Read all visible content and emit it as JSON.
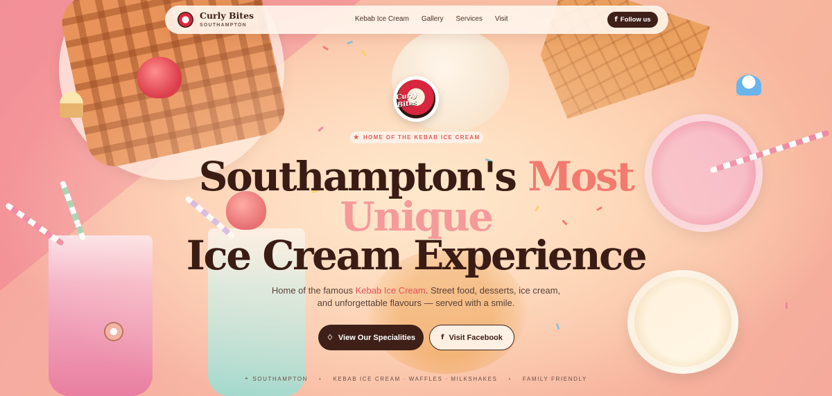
{
  "nav": {
    "brand_name": "Curly Bites",
    "brand_sub": "SOUTHAMPTON",
    "menu": [
      {
        "label": "Kebab Ice Cream"
      },
      {
        "label": "Gallery"
      },
      {
        "label": "Services"
      },
      {
        "label": "Visit"
      }
    ],
    "follow_label": "Follow us"
  },
  "hero": {
    "logo_text": "Curly Bites",
    "badge": "HOME OF THE KEBAB ICE CREAM",
    "title_line1_a": "Southampton's ",
    "title_line1_b": "Most",
    "title_line2": "Unique",
    "title_line3": "Ice Cream Experience",
    "subtitle_a": "Home of the famous ",
    "subtitle_highlight": "Kebab Ice Cream",
    "subtitle_b": ". Street food, desserts, ice cream,",
    "subtitle_line2": "and unforgettable flavours — served with a smile.",
    "primary_button": "View Our Specialities",
    "secondary_button": "Visit Facebook"
  },
  "info_bar": {
    "location": "SOUTHAMPTON",
    "products": "KEBAB ICE CREAM · WAFFLES · MILKSHAKES",
    "tagline": "FAMILY FRIENDLY"
  },
  "colors": {
    "dark": "#3f2018",
    "accent": "#f27a6f",
    "highlight": "#e8505a"
  },
  "icons": [
    "facebook-icon",
    "star-icon",
    "ice-cream-icon",
    "location-pin-icon"
  ]
}
